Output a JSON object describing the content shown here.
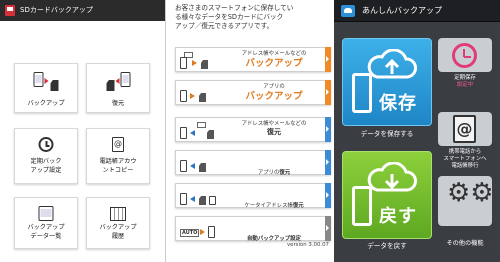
{
  "panel1": {
    "title": "SDカードバックアップ",
    "tiles": [
      {
        "line1": "バックアップ",
        "line2": ""
      },
      {
        "line1": "復元",
        "line2": ""
      },
      {
        "line1": "定期バック",
        "line2": "アップ設定"
      },
      {
        "line1": "電話帳アカウ",
        "line2": "ントコピー"
      },
      {
        "line1": "バックアップ",
        "line2": "データ一覧"
      },
      {
        "line1": "バックアップ",
        "line2": "履歴"
      }
    ]
  },
  "panel2": {
    "intro_line1": "お客さまのスマートフォンに保存してい",
    "intro_line2": "る様々なデータをSDカードにバック",
    "intro_line3": "アップ／復元できるアプリです。",
    "items": [
      {
        "small": "アドレス帳やメールなどの",
        "big": "バックアップ"
      },
      {
        "small": "アプリの",
        "big": "バックアップ"
      },
      {
        "small": "アドレス帳やメールなどの",
        "big": "復元"
      },
      {
        "small": "アプリの",
        "big": "復元"
      },
      {
        "small": "ケータイアドレス帳",
        "big": "復元"
      },
      {
        "small": "自動バックアップ設定",
        "big": "",
        "auto": "AUTO"
      }
    ],
    "version": "version 3.00.07"
  },
  "panel3": {
    "title": "あんしんバックアップ",
    "save_word": "保存",
    "save_caption": "データを保存する",
    "restore_word": "戻す",
    "restore_caption": "データを戻す",
    "scheduled_label": "定期保存",
    "scheduled_status": "設定中",
    "transfer_line1": "携帯電話から",
    "transfer_line2": "スマートフォンへ",
    "transfer_line3": "電話帳移行",
    "other_label": "その他の機能"
  },
  "colors": {
    "accent_red": "#d6303b",
    "orange": "#e07a1f",
    "blue": "#2f76c2",
    "save_blue": "#2a9bdc",
    "restore_green": "#72b92b",
    "dark_bg": "#3a3d42",
    "pink": "#e23b7a"
  },
  "icons": [
    "phone-sd-icon",
    "sd-phone-icon",
    "clock-icon",
    "address-book-icon",
    "data-list-icon",
    "calendar-icon",
    "cloud-upload-icon",
    "cloud-download-icon",
    "gear-icon"
  ]
}
